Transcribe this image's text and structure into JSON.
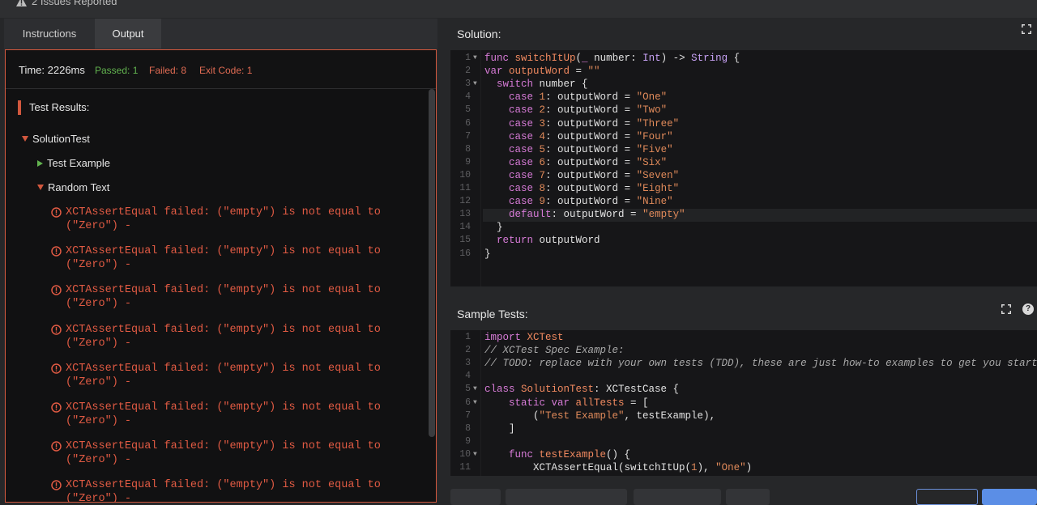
{
  "header": {
    "issues_text": "2 Issues Reported"
  },
  "left_tabs": [
    {
      "label": "Instructions"
    },
    {
      "label": "Output"
    }
  ],
  "output": {
    "time": "Time: 2226ms",
    "passed": "Passed: 1",
    "failed": "Failed: 8",
    "exit_code": "Exit Code: 1",
    "results_title": "Test Results:",
    "suite": "SolutionTest",
    "test_example": "Test Example",
    "random_text": "Random Text",
    "failures": [
      "XCTAssertEqual failed: (\"empty\") is not equal to\n(\"Zero\") -",
      "XCTAssertEqual failed: (\"empty\") is not equal to\n(\"Zero\") -",
      "XCTAssertEqual failed: (\"empty\") is not equal to\n(\"Zero\") -",
      "XCTAssertEqual failed: (\"empty\") is not equal to\n(\"Zero\") -",
      "XCTAssertEqual failed: (\"empty\") is not equal to\n(\"Zero\") -",
      "XCTAssertEqual failed: (\"empty\") is not equal to\n(\"Zero\") -",
      "XCTAssertEqual failed: (\"empty\") is not equal to\n(\"Zero\") -",
      "XCTAssertEqual failed: (\"empty\") is not equal to\n(\"Zero\") -"
    ]
  },
  "solution": {
    "title": "Solution:",
    "lines": [
      [
        [
          "kw",
          "func "
        ],
        [
          "fn",
          "switchItUp"
        ],
        [
          "pl",
          "("
        ],
        [
          "kw",
          "_ "
        ],
        [
          "pl",
          "number: "
        ],
        [
          "ty",
          "Int"
        ],
        [
          "pl",
          ") -> "
        ],
        [
          "ty",
          "String"
        ],
        [
          "pl",
          " {"
        ]
      ],
      [
        [
          "kw",
          "var "
        ],
        [
          "fn",
          "outputWord"
        ],
        [
          "pl",
          " = "
        ],
        [
          "str",
          "\"\""
        ]
      ],
      [
        [
          "pl",
          "  "
        ],
        [
          "kw",
          "switch "
        ],
        [
          "pl",
          "number {"
        ]
      ],
      [
        [
          "pl",
          "    "
        ],
        [
          "kw",
          "case "
        ],
        [
          "str",
          "1"
        ],
        [
          "pl",
          ": outputWord = "
        ],
        [
          "str",
          "\"One\""
        ]
      ],
      [
        [
          "pl",
          "    "
        ],
        [
          "kw",
          "case "
        ],
        [
          "str",
          "2"
        ],
        [
          "pl",
          ": outputWord = "
        ],
        [
          "str",
          "\"Two\""
        ]
      ],
      [
        [
          "pl",
          "    "
        ],
        [
          "kw",
          "case "
        ],
        [
          "str",
          "3"
        ],
        [
          "pl",
          ": outputWord = "
        ],
        [
          "str",
          "\"Three\""
        ]
      ],
      [
        [
          "pl",
          "    "
        ],
        [
          "kw",
          "case "
        ],
        [
          "str",
          "4"
        ],
        [
          "pl",
          ": outputWord = "
        ],
        [
          "str",
          "\"Four\""
        ]
      ],
      [
        [
          "pl",
          "    "
        ],
        [
          "kw",
          "case "
        ],
        [
          "str",
          "5"
        ],
        [
          "pl",
          ": outputWord = "
        ],
        [
          "str",
          "\"Five\""
        ]
      ],
      [
        [
          "pl",
          "    "
        ],
        [
          "kw",
          "case "
        ],
        [
          "str",
          "6"
        ],
        [
          "pl",
          ": outputWord = "
        ],
        [
          "str",
          "\"Six\""
        ]
      ],
      [
        [
          "pl",
          "    "
        ],
        [
          "kw",
          "case "
        ],
        [
          "str",
          "7"
        ],
        [
          "pl",
          ": outputWord = "
        ],
        [
          "str",
          "\"Seven\""
        ]
      ],
      [
        [
          "pl",
          "    "
        ],
        [
          "kw",
          "case "
        ],
        [
          "str",
          "8"
        ],
        [
          "pl",
          ": outputWord = "
        ],
        [
          "str",
          "\"Eight\""
        ]
      ],
      [
        [
          "pl",
          "    "
        ],
        [
          "kw",
          "case "
        ],
        [
          "str",
          "9"
        ],
        [
          "pl",
          ": outputWord = "
        ],
        [
          "str",
          "\"Nine\""
        ]
      ],
      [
        [
          "pl",
          "    "
        ],
        [
          "kw",
          "default"
        ],
        [
          "pl",
          ": outputWord = "
        ],
        [
          "str",
          "\"empty\""
        ]
      ],
      [
        [
          "pl",
          "  }"
        ]
      ],
      [
        [
          "pl",
          "  "
        ],
        [
          "kw",
          "return "
        ],
        [
          "pl",
          "outputWord"
        ]
      ],
      [
        [
          "pl",
          "}"
        ]
      ]
    ],
    "fold_lines": [
      "1",
      "3"
    ]
  },
  "sample_tests": {
    "title": "Sample Tests:",
    "lines": [
      [
        [
          "kw",
          "import "
        ],
        [
          "fn",
          "XCTest"
        ]
      ],
      [
        [
          "cmt",
          "// XCTest Spec Example:"
        ]
      ],
      [
        [
          "cmt",
          "// TODO: replace with your own tests (TDD), these are just how-to examples to get you started"
        ]
      ],
      [
        [
          "pl",
          ""
        ]
      ],
      [
        [
          "kw",
          "class "
        ],
        [
          "fn",
          "SolutionTest"
        ],
        [
          "pl",
          ": XCTestCase {"
        ]
      ],
      [
        [
          "pl",
          "    "
        ],
        [
          "kw",
          "static var "
        ],
        [
          "fn",
          "allTests"
        ],
        [
          "pl",
          " = ["
        ]
      ],
      [
        [
          "pl",
          "        ("
        ],
        [
          "str",
          "\"Test Example\""
        ],
        [
          "pl",
          ", testExample),"
        ]
      ],
      [
        [
          "pl",
          "    ]"
        ]
      ],
      [
        [
          "pl",
          ""
        ]
      ],
      [
        [
          "pl",
          "    "
        ],
        [
          "kw",
          "func "
        ],
        [
          "fn",
          "testExample"
        ],
        [
          "pl",
          "() {"
        ]
      ],
      [
        [
          "pl",
          "        XCTAssertEqual(switchItUp("
        ],
        [
          "str",
          "1"
        ],
        [
          "pl",
          "), "
        ],
        [
          "str",
          "\"One\""
        ],
        [
          "pl",
          ")"
        ]
      ]
    ],
    "fold_lines": [
      "5",
      "6",
      "10"
    ]
  }
}
